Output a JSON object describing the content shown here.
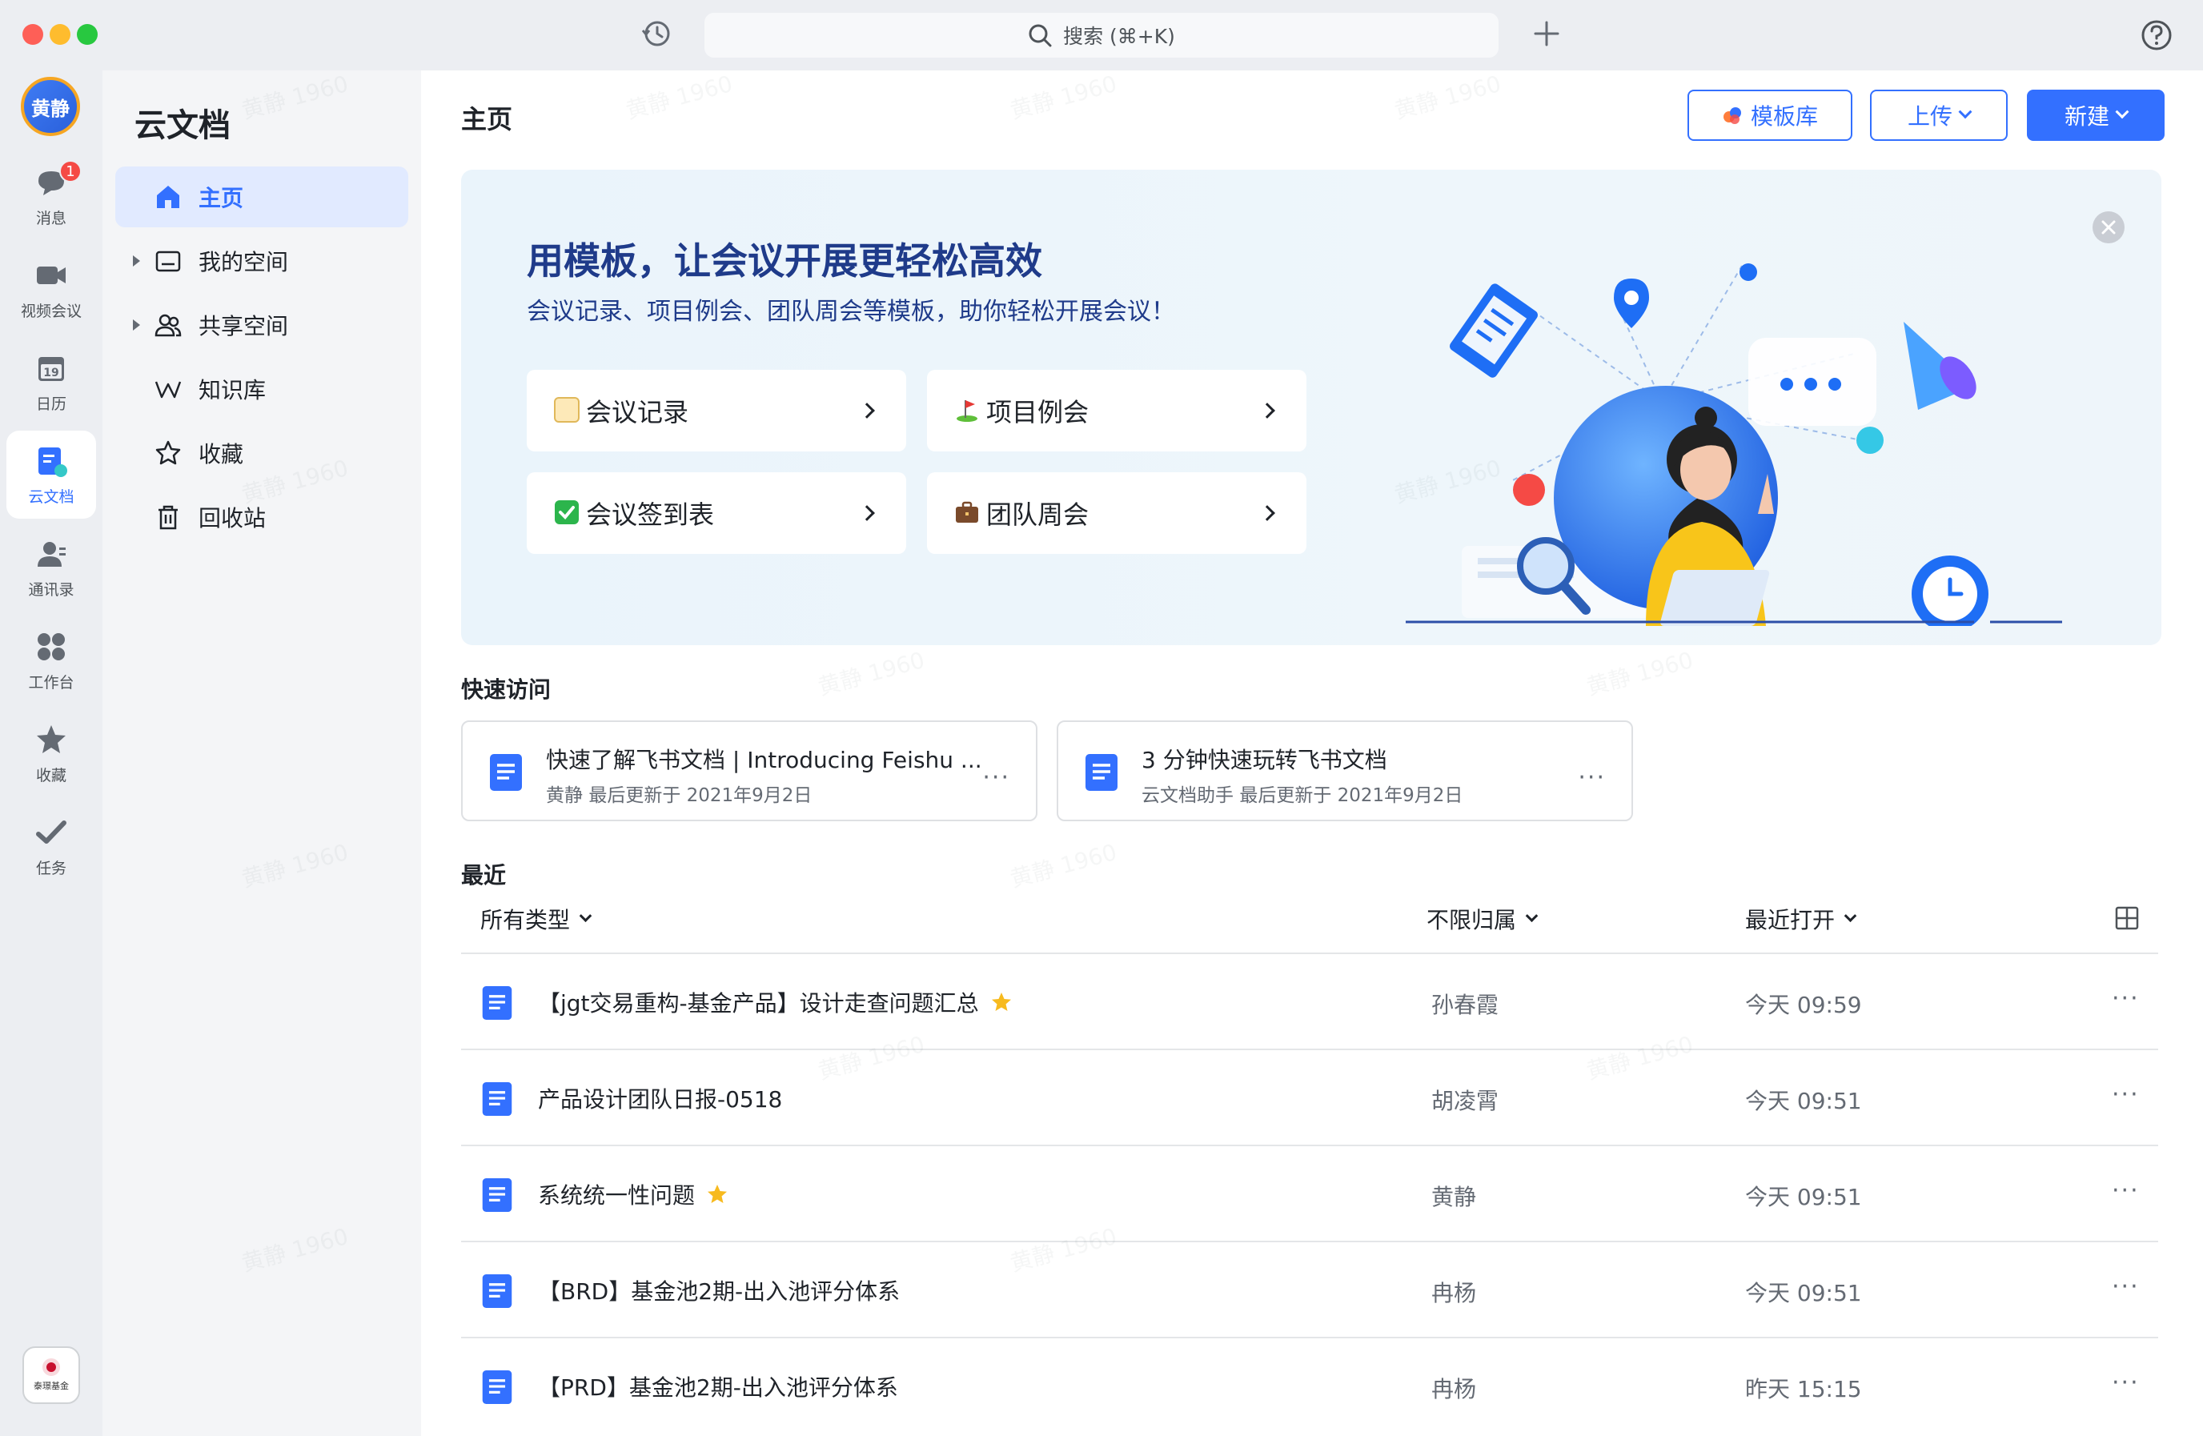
{
  "titlebar": {
    "search_placeholder": "搜索 (⌘+K)"
  },
  "rail": {
    "avatar_text": "黄静",
    "items": [
      {
        "label": "消息",
        "badge": "1"
      },
      {
        "label": "视频会议"
      },
      {
        "label": "日历",
        "cal_day": "19"
      },
      {
        "label": "云文档"
      },
      {
        "label": "通讯录"
      },
      {
        "label": "工作台"
      },
      {
        "label": "收藏"
      },
      {
        "label": "任务"
      }
    ],
    "org_logo_text": "泰璟基金"
  },
  "sidebar": {
    "title": "云文档",
    "items": [
      {
        "label": "主页"
      },
      {
        "label": "我的空间"
      },
      {
        "label": "共享空间"
      },
      {
        "label": "知识库"
      },
      {
        "label": "收藏"
      },
      {
        "label": "回收站"
      }
    ]
  },
  "main": {
    "page_title": "主页",
    "buttons": {
      "templates": "模板库",
      "upload": "上传",
      "new": "新建"
    },
    "banner": {
      "title": "用模板，让会议开展更轻松高效",
      "subtitle": "会议记录、项目例会、团队周会等模板，助你轻松开展会议！",
      "cards": [
        {
          "label": "会议记录"
        },
        {
          "label": "项目例会"
        },
        {
          "label": "会议签到表"
        },
        {
          "label": "团队周会"
        }
      ]
    },
    "quick": {
      "title": "快速访问",
      "items": [
        {
          "title": "快速了解飞书文档 | Introducing Feishu ...",
          "owner": "黄静",
          "updated": "最后更新于 2021年9月2日"
        },
        {
          "title": "3 分钟快速玩转飞书文档",
          "owner": "云文档助手",
          "updated": "最后更新于 2021年9月2日"
        }
      ]
    },
    "recent": {
      "title": "最近",
      "filters": {
        "type": "所有类型",
        "owner": "不限归属",
        "sort": "最近打开"
      },
      "rows": [
        {
          "name": "【jgt交易重构-基金产品】设计走查问题汇总",
          "starred": true,
          "owner": "孙春霞",
          "time": "今天 09:59"
        },
        {
          "name": "产品设计团队日报-0518",
          "starred": false,
          "owner": "胡凌霄",
          "time": "今天 09:51"
        },
        {
          "name": "系统统一性问题",
          "starred": true,
          "owner": "黄静",
          "time": "今天 09:51"
        },
        {
          "name": "【BRD】基金池2期-出入池评分体系",
          "starred": false,
          "owner": "冉杨",
          "time": "今天 09:51"
        },
        {
          "name": "【PRD】基金池2期-出入池评分体系",
          "starred": false,
          "owner": "冉杨",
          "time": "昨天 15:15"
        }
      ]
    }
  },
  "watermark": "黄静 1960",
  "colors": {
    "accent": "#3370ff",
    "banner_text": "#1f3b8a",
    "badge": "#f54a45",
    "star": "#f7ba1e"
  }
}
